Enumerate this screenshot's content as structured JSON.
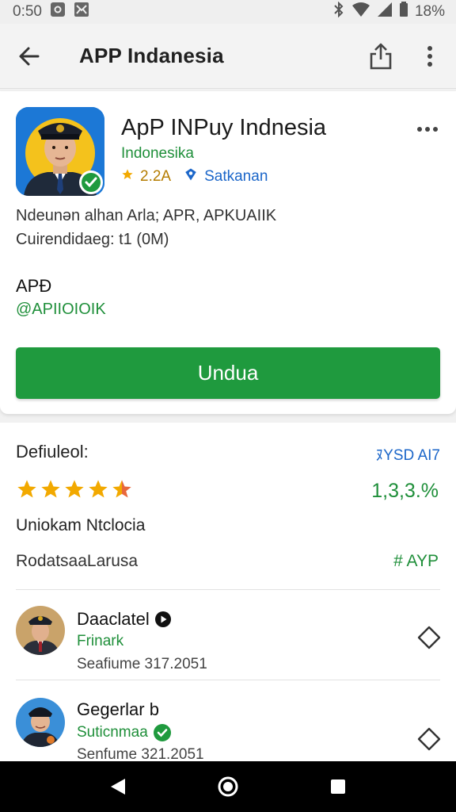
{
  "status_bar": {
    "time": "0:50",
    "battery": "18%"
  },
  "app_bar": {
    "title": "APP Indanesia"
  },
  "app": {
    "name": "ApP INPuy Indnesia",
    "developer": "Indonesika",
    "rating": "2.2A",
    "verified_label": "Satkanan",
    "description_line1": "Ndeunən alhan Arla; APR, APKUAIIK",
    "description_line2": "Cuirendidaeg: t1 (0M)",
    "apk_title": "APĐ",
    "apk_handle": "@APIIOIOIK",
    "download_label": "Undua"
  },
  "ratings": {
    "title": "Defiuleol:",
    "link": "ﾇYSD AI7",
    "stars": 4.5,
    "percent": "1,3,3.%",
    "subtitle": "Uniokam Ntclocia",
    "row_label": "RodatsaaLarusa",
    "row_value": "# AYP"
  },
  "list": [
    {
      "name": "Daaclatel",
      "status": "Frinark",
      "date": "Seafiume 317.2051"
    },
    {
      "name": "Gegerlar b",
      "status": "Suticnmaa",
      "date": "Senfume 321.2051"
    }
  ],
  "colors": {
    "accent_green": "#1f9a3e",
    "link_blue": "#1b66c9",
    "star": "#f2a900"
  }
}
